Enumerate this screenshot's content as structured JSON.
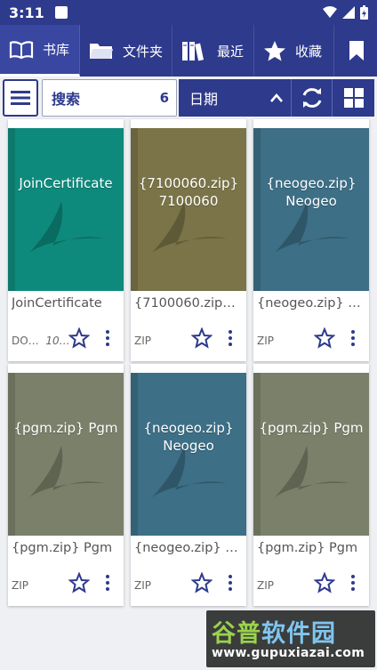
{
  "status_bar": {
    "time": "3:11"
  },
  "tabs": [
    {
      "label": "书库",
      "icon": "book-open-icon",
      "active": true
    },
    {
      "label": "文件夹",
      "icon": "folder-icon"
    },
    {
      "label": "最近",
      "icon": "books-icon"
    },
    {
      "label": "收藏",
      "icon": "star-icon"
    },
    {
      "label": "",
      "icon": "bookmark-icon"
    }
  ],
  "toolbar": {
    "search_placeholder": "搜索",
    "count": "6",
    "sort_label": "日期"
  },
  "books": [
    {
      "cover_text": "JoinCertificate",
      "title": "JoinCertificate",
      "format": "DO…",
      "date": "10…",
      "cover_color": "#0e8a7c"
    },
    {
      "cover_text": "{7100060.zip} 7100060",
      "title": "{7100060.zip}...",
      "format": "ZIP",
      "date": "",
      "cover_color": "#7a7448"
    },
    {
      "cover_text": "{neogeo.zip} Neogeo",
      "title": "{neogeo.zip} N...",
      "format": "ZIP",
      "date": "",
      "cover_color": "#3d6f86"
    },
    {
      "cover_text": "{pgm.zip} Pgm",
      "title": "{pgm.zip} Pgm",
      "format": "ZIP",
      "date": "",
      "cover_color": "#7a806a"
    },
    {
      "cover_text": "{neogeo.zip} Neogeo",
      "title": "{neogeo.zip} N...",
      "format": "ZIP",
      "date": "",
      "cover_color": "#3d6f86"
    },
    {
      "cover_text": "{pgm.zip} Pgm",
      "title": "{pgm.zip} Pgm",
      "format": "ZIP",
      "date": "",
      "cover_color": "#7a806a"
    }
  ],
  "watermark": {
    "name_part1": "谷普",
    "name_part2": "软件园",
    "url": "www.gupuxiazai.com"
  },
  "colors": {
    "primary": "#2e3a8c",
    "background": "#eef0f3"
  }
}
